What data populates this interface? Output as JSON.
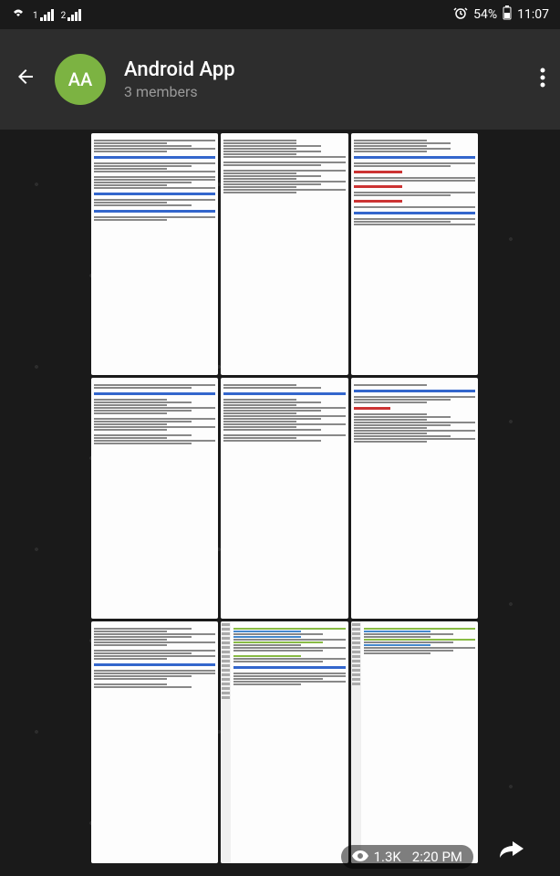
{
  "status": {
    "sim1": "1",
    "sim2": "2",
    "battery_pct": "54%",
    "time": "11:07"
  },
  "header": {
    "avatar_initials": "AA",
    "title": "Android App",
    "subtitle": "3 members"
  },
  "message": {
    "views": "1.3K",
    "time": "2:20 PM"
  },
  "media": {
    "cells": [
      {
        "type": "doc",
        "hint": "Class and function"
      },
      {
        "type": "doc",
        "hint": "class students"
      },
      {
        "type": "doc",
        "hint": "Private, Protected, Public"
      },
      {
        "type": "doc",
        "hint": "Constructor"
      },
      {
        "type": "doc",
        "hint": "class name"
      },
      {
        "type": "doc",
        "hint": "Copy Constructor"
      },
      {
        "type": "code",
        "hint": "code listing"
      },
      {
        "type": "code",
        "hint": "Inline function member"
      },
      {
        "type": "code",
        "hint": "code listing"
      }
    ]
  }
}
